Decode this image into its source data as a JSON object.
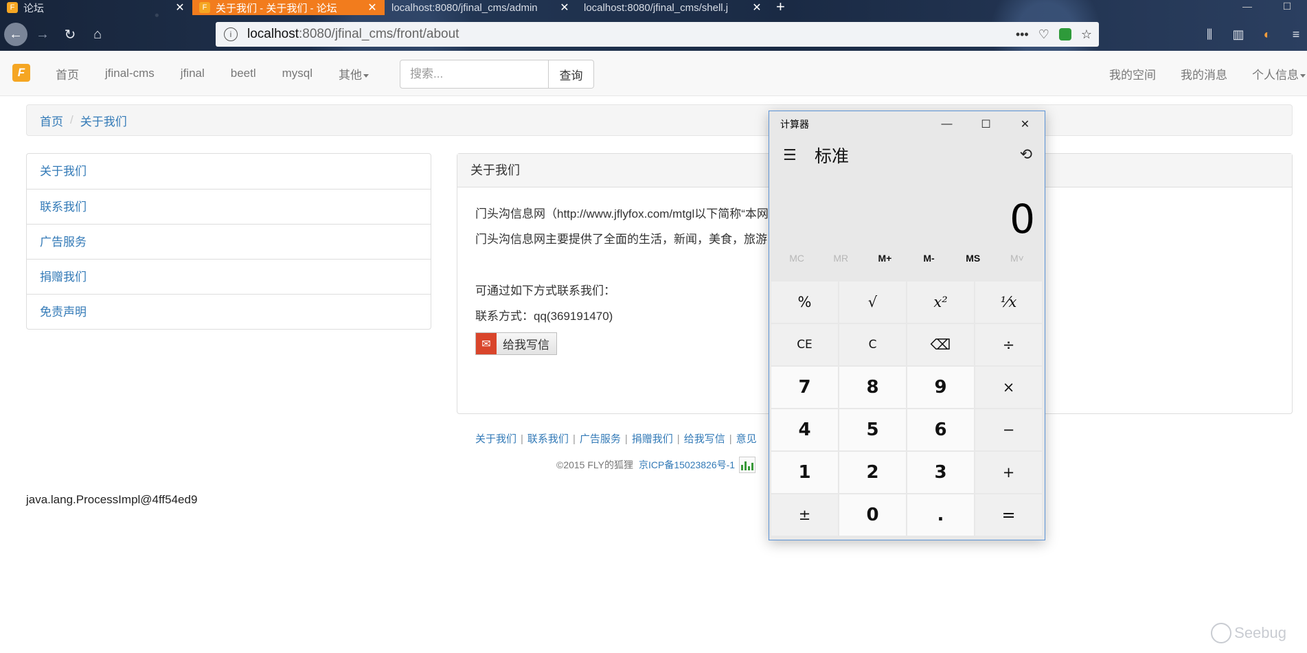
{
  "browser": {
    "tabs": [
      {
        "title": "论坛",
        "active": false
      },
      {
        "title": "关于我们 - 关于我们 - 论坛",
        "active": true
      },
      {
        "title": "localhost:8080/jfinal_cms/admin",
        "active": false
      },
      {
        "title": "localhost:8080/jfinal_cms/shell.j",
        "active": false
      }
    ],
    "new_tab": "+",
    "url_host": "localhost",
    "url_path": ":8080/jfinal_cms/front/about"
  },
  "site": {
    "logo": "F",
    "nav": [
      "首页",
      "jfinal-cms",
      "jfinal",
      "beetl",
      "mysql",
      "其他"
    ],
    "search_placeholder": "搜索...",
    "search_button": "查询",
    "nav_right": [
      "我的空间",
      "我的消息",
      "个人信息"
    ]
  },
  "breadcrumb": [
    "首页",
    "关于我们"
  ],
  "sidebar": [
    "关于我们",
    "联系我们",
    "广告服务",
    "捐赠我们",
    "免责声明"
  ],
  "panel": {
    "heading": "关于我们",
    "line1": "门头沟信息网（http://www.jflyfox.com/mtgl以下简称“本网",
    "line2": "门头沟信息网主要提供了全面的生活，新闻，美食，旅游",
    "line3": "可通过如下方式联系我们：",
    "line4": "联系方式：qq(369191470)",
    "mail_button": "给我写信"
  },
  "footer": {
    "links": [
      "关于我们",
      "联系我们",
      "广告服务",
      "捐赠我们",
      "给我写信",
      "意见"
    ],
    "copyright": "©2015 FLY的狐狸",
    "icp": "京ICP备15023826号-1"
  },
  "process_text": "java.lang.ProcessImpl@4ff54ed9",
  "watermark": "Seebug",
  "calculator": {
    "title": "计算器",
    "mode": "标准",
    "display": "0",
    "memory": [
      {
        "label": "MC",
        "enabled": false
      },
      {
        "label": "MR",
        "enabled": false
      },
      {
        "label": "M+",
        "enabled": true
      },
      {
        "label": "M-",
        "enabled": true
      },
      {
        "label": "MS",
        "enabled": true
      },
      {
        "label": "M˅",
        "enabled": false
      }
    ],
    "keys": [
      "%",
      "√",
      "x²",
      "¹⁄x",
      "CE",
      "C",
      "⌫",
      "÷",
      "7",
      "8",
      "9",
      "×",
      "4",
      "5",
      "6",
      "−",
      "1",
      "2",
      "3",
      "+",
      "±",
      "0",
      ".",
      "="
    ]
  }
}
